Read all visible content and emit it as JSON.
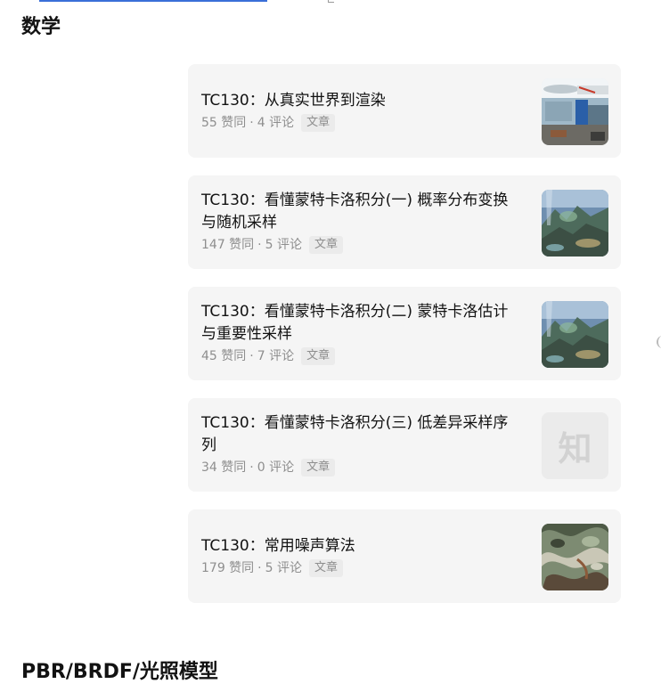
{
  "sections": [
    {
      "title": "数学"
    },
    {
      "title": "PBR/BRDF/光照模型"
    }
  ],
  "articles": [
    {
      "title": "TC130：从真实世界到渲染",
      "likes": "55 赞同",
      "comments": "4 评论",
      "type": "文章",
      "thumbnail": "classroom-photo"
    },
    {
      "title": "TC130：看懂蒙特卡洛积分(一) 概率分布变换与随机采样",
      "likes": "147 赞同",
      "comments": "5 评论",
      "type": "文章",
      "thumbnail": "fantasy-landscape"
    },
    {
      "title": "TC130：看懂蒙特卡洛积分(二) 蒙特卡洛估计与重要性采样",
      "likes": "45 赞同",
      "comments": "7 评论",
      "type": "文章",
      "thumbnail": "fantasy-landscape"
    },
    {
      "title": "TC130：看懂蒙特卡洛积分(三) 低差异采样序列",
      "likes": "34 赞同",
      "comments": "0 评论",
      "type": "文章",
      "thumbnail": "zhihu-placeholder",
      "placeholder_text": "知"
    },
    {
      "title": "TC130：常用噪声算法",
      "likes": "179 赞同",
      "comments": "5 评论",
      "type": "文章",
      "thumbnail": "noise-texture"
    }
  ],
  "meta_separator": "·"
}
